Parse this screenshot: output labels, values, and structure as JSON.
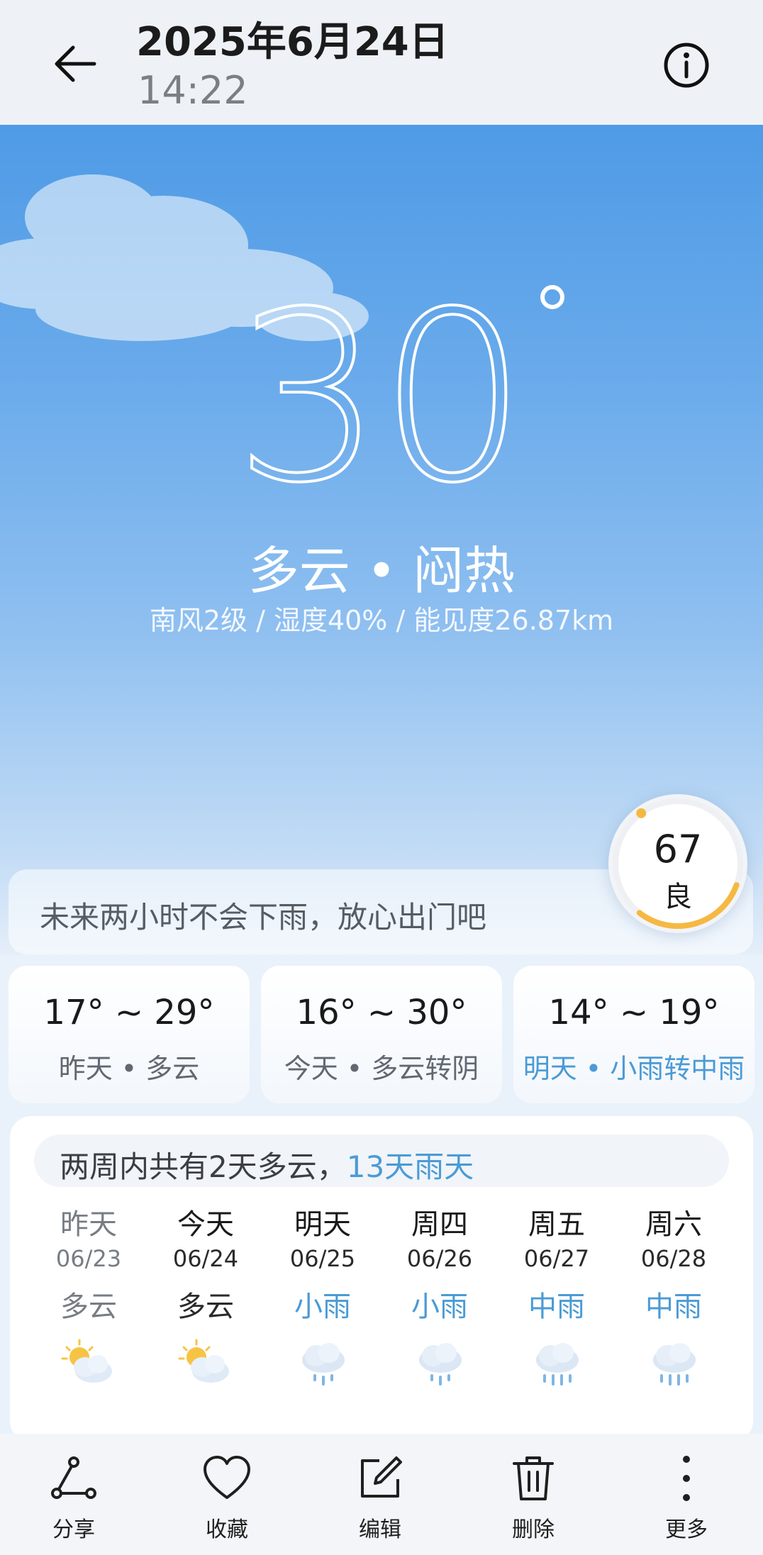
{
  "header": {
    "date": "2025年6月24日",
    "time": "14:22"
  },
  "current": {
    "temperature": "30",
    "condition": "多云 • 闷热",
    "details": "南风2级  /  湿度40%  /  能见度26.87km"
  },
  "aqi": {
    "value": "67",
    "label": "良",
    "level_fraction": 0.3
  },
  "notice": "未来两小时不会下雨，放心出门吧",
  "day_cards": [
    {
      "range": "17° ~ 29°",
      "desc": "昨天 • 多云"
    },
    {
      "range": "16° ~ 30°",
      "desc": "今天 • 多云转阴"
    },
    {
      "range": "14° ~ 19°",
      "desc": "明天 • 小雨转中雨"
    }
  ],
  "forecast": {
    "summary_prefix": "两周内共有2天多云，",
    "summary_highlight": "13天雨天",
    "days": [
      {
        "name": "昨天",
        "date": "06/23",
        "weather": "多云",
        "icon": "partly-cloudy-icon"
      },
      {
        "name": "今天",
        "date": "06/24",
        "weather": "多云",
        "icon": "partly-cloudy-icon"
      },
      {
        "name": "明天",
        "date": "06/25",
        "weather": "小雨",
        "icon": "light-rain-icon"
      },
      {
        "name": "周四",
        "date": "06/26",
        "weather": "小雨",
        "icon": "light-rain-icon"
      },
      {
        "name": "周五",
        "date": "06/27",
        "weather": "中雨",
        "icon": "moderate-rain-icon"
      },
      {
        "name": "周六",
        "date": "06/28",
        "weather": "中雨",
        "icon": "moderate-rain-icon"
      }
    ]
  },
  "toolbar": {
    "share": "分享",
    "favorite": "收藏",
    "edit": "编辑",
    "delete": "删除",
    "more": "更多"
  },
  "colors": {
    "sky_top": "#4f9be6",
    "accent_blue": "#4a9bd6",
    "aqi_ring": "#f5b942"
  }
}
